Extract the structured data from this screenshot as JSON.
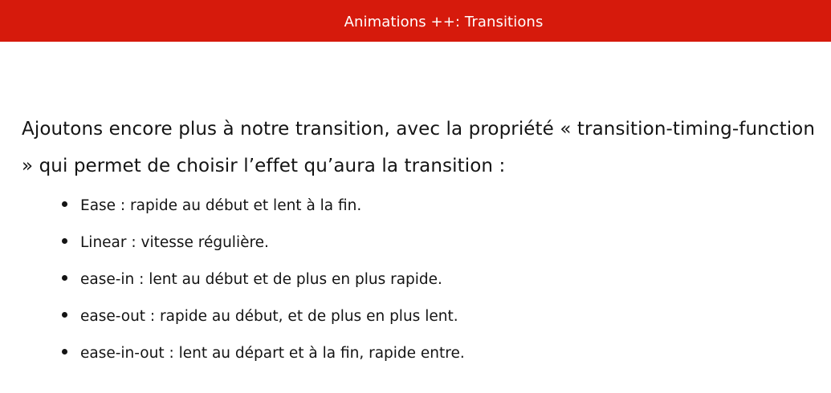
{
  "header": {
    "title": "Animations ++: Transitions",
    "background_color": "#d61a0c"
  },
  "content": {
    "intro_text": "Ajoutons encore plus à notre transition, avec la propriété « transition-timing-function » qui permet de choisir l’effet qu’aura la transition :",
    "bullets": [
      "Ease : rapide au début et lent à la fin.",
      "Linear : vitesse régulière.",
      "ease-in : lent au début et de plus en plus rapide.",
      "ease-out : rapide au début, et de plus en plus lent.",
      "ease-in-out : lent au départ et à la fin, rapide entre."
    ]
  }
}
